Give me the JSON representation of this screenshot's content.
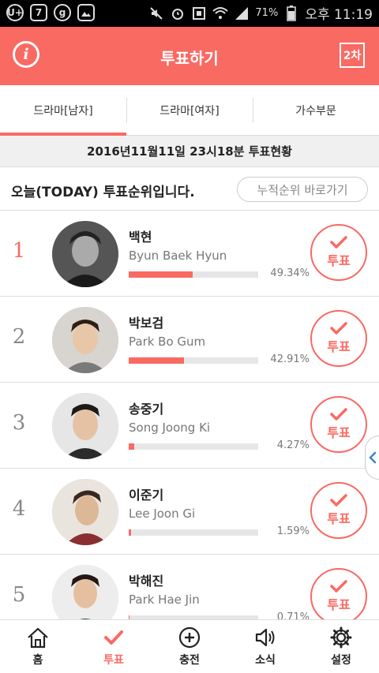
{
  "status_bar": {
    "left_badges": [
      "U+",
      "7",
      "g"
    ],
    "battery": "71%",
    "time": "오후 11:19"
  },
  "header": {
    "title": "투표하기",
    "round_label": "2차"
  },
  "tabs": [
    {
      "label": "드라마[남자]",
      "active": true
    },
    {
      "label": "드라마[여자]",
      "active": false
    },
    {
      "label": "가수부문",
      "active": false
    }
  ],
  "status_line": "2016년11월11일 23시18분 투표현황",
  "ranking": {
    "title": "오늘(TODAY) 투표순위입니다.",
    "cumulative_button": "누적순위 바로가기"
  },
  "vote_button_label": "투표",
  "candidates": [
    {
      "rank": "1",
      "name_ko": "백현",
      "name_en": "Byun Baek Hyun",
      "percent": "49.34%",
      "value": 49.34
    },
    {
      "rank": "2",
      "name_ko": "박보검",
      "name_en": "Park Bo Gum",
      "percent": "42.91%",
      "value": 42.91
    },
    {
      "rank": "3",
      "name_ko": "송중기",
      "name_en": "Song Joong Ki",
      "percent": "4.27%",
      "value": 4.27
    },
    {
      "rank": "4",
      "name_ko": "이준기",
      "name_en": "Lee Joon Gi",
      "percent": "1.59%",
      "value": 1.59
    },
    {
      "rank": "5",
      "name_ko": "박해진",
      "name_en": "Park Hae Jin",
      "percent": "0.71%",
      "value": 0.71
    }
  ],
  "bottom_nav": [
    {
      "label": "홈",
      "icon": "home-icon",
      "active": false
    },
    {
      "label": "투표",
      "icon": "check-icon",
      "active": true
    },
    {
      "label": "충전",
      "icon": "plus-circle-icon",
      "active": false
    },
    {
      "label": "소식",
      "icon": "speaker-icon",
      "active": false
    },
    {
      "label": "설정",
      "icon": "gear-icon",
      "active": false
    }
  ],
  "colors": {
    "accent": "#f96a63",
    "side_handle": "#3a86c8"
  }
}
